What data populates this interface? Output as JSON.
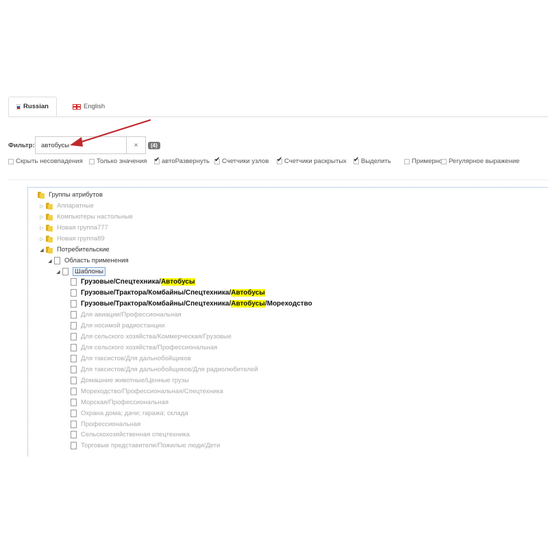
{
  "tabs": [
    {
      "label": "Russian",
      "active": true,
      "flag": "russia-flag-icon"
    },
    {
      "label": "English",
      "active": false,
      "flag": "uk-flag-icon"
    }
  ],
  "filter": {
    "label": "Фильтр:",
    "value": "автобусы",
    "clear_label": "×",
    "count": "(4)"
  },
  "options": [
    {
      "label": "Скрыть несовпадения",
      "checked": false
    },
    {
      "label": "Только значения",
      "checked": false
    },
    {
      "label": "автоРазвернуть",
      "checked": true
    },
    {
      "label": "Счетчики узлов",
      "checked": true
    },
    {
      "label": "Счетчики раскрытых",
      "checked": true
    },
    {
      "label": "Выделить",
      "checked": true
    },
    {
      "label": "Примерно",
      "checked": false
    },
    {
      "label": "Регулярное выражение",
      "checked": false
    }
  ],
  "tree": {
    "root": "Группы атрибутов",
    "groups": [
      "Аппаратные",
      "Компьютеры настольные",
      "Новая группа777",
      "Новая группа89",
      "Потребительские"
    ],
    "area": "Область применения",
    "templates": "Шаблоны",
    "matches": [
      {
        "pre": "Грузовые/Спецтехника/",
        "hl": "Автобусы",
        "post": ""
      },
      {
        "pre": "Грузовые/Трактора/Комбайны/Спецтехника/",
        "hl": "Автобусы",
        "post": ""
      },
      {
        "pre": "Грузовые/Трактора/Комбайны/Спецтехника/",
        "hl": "Автобусы",
        "post": "/Мореходство"
      }
    ],
    "others": [
      "Для авиации/Профессиональная",
      "Для носимой радиостанции",
      "Для сельского хозяйства/Коммерческая/Грузовые",
      "Для сельского хозяйства/Профессиональная",
      "Для таксистов/Для дальнобойщиков",
      "Для таксистов/Для дальнобойщиков/Для радиолюбителей",
      "Домашние животные/Ценные грузы",
      "Мореходство/Профессиональная/Спецтехника",
      "Морская/Профессиональная",
      "Охрана дома; дачи; гаража; склада",
      "Профессиональная",
      "Сельскохозяйственная спецтехника",
      "Торговые представители/Пожилые люди/Дети"
    ]
  },
  "colors": {
    "highlight": "#ffff00",
    "annotation_arrow": "#c0272d"
  }
}
